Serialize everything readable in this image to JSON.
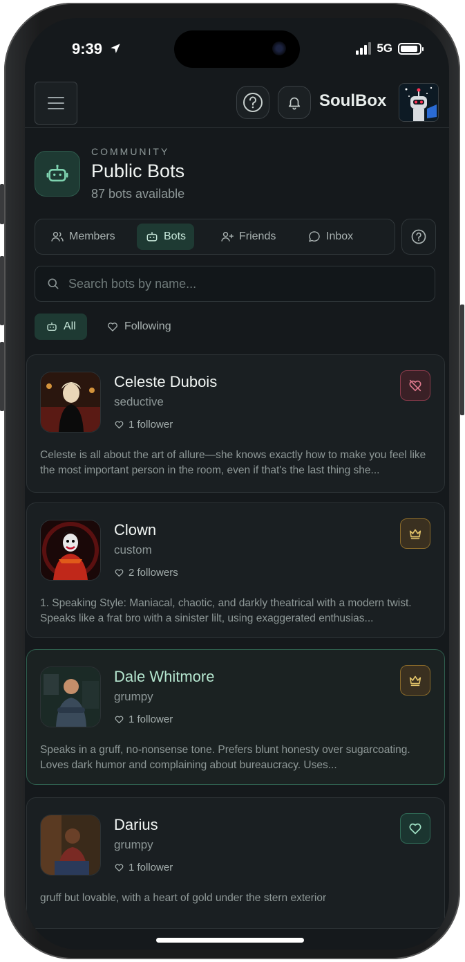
{
  "status": {
    "time": "9:39",
    "network": "5G"
  },
  "header": {
    "brand": "SoulBox"
  },
  "community": {
    "eyebrow": "COMMUNITY",
    "title": "Public Bots",
    "subtitle": "87 bots available"
  },
  "tabs": [
    {
      "label": "Members",
      "icon": "users-icon"
    },
    {
      "label": "Bots",
      "icon": "bot-icon",
      "active": true
    },
    {
      "label": "Friends",
      "icon": "user-plus-icon"
    },
    {
      "label": "Inbox",
      "icon": "chat-icon"
    }
  ],
  "search": {
    "placeholder": "Search bots by name..."
  },
  "filters": [
    {
      "label": "All",
      "icon": "bot-icon",
      "active": true
    },
    {
      "label": "Following",
      "icon": "heart-icon"
    }
  ],
  "bots": [
    {
      "name": "Celeste Dubois",
      "personality": "seductive",
      "followers": "1 follower",
      "description": "Celeste is all about the art of allure—she knows exactly how to make you feel like the most important person in the room, even if that's the last thing she...",
      "action": "unfollow-icon"
    },
    {
      "name": "Clown",
      "personality": "custom",
      "followers": "2 followers",
      "description": "1. Speaking Style: Maniacal, chaotic, and darkly theatrical with a modern twist. Speaks like a frat bro with a sinister lilt, using exaggerated enthusias...",
      "action": "crown-icon"
    },
    {
      "name": "Dale Whitmore",
      "personality": "grumpy",
      "followers": "1 follower",
      "description": "Speaks in a gruff, no-nonsense tone. Prefers blunt honesty over sugarcoating. Loves dark humor and complaining about bureaucracy. Uses...",
      "action": "crown-icon"
    },
    {
      "name": "Darius",
      "personality": "grumpy",
      "followers": "1 follower",
      "description": "gruff but lovable, with a heart of gold under the stern exterior",
      "action": "heart-icon"
    }
  ],
  "colors": {
    "accent": "#1e3a33",
    "background": "#15191c",
    "danger": "#8a3a4a",
    "gold": "#c9a24a"
  }
}
